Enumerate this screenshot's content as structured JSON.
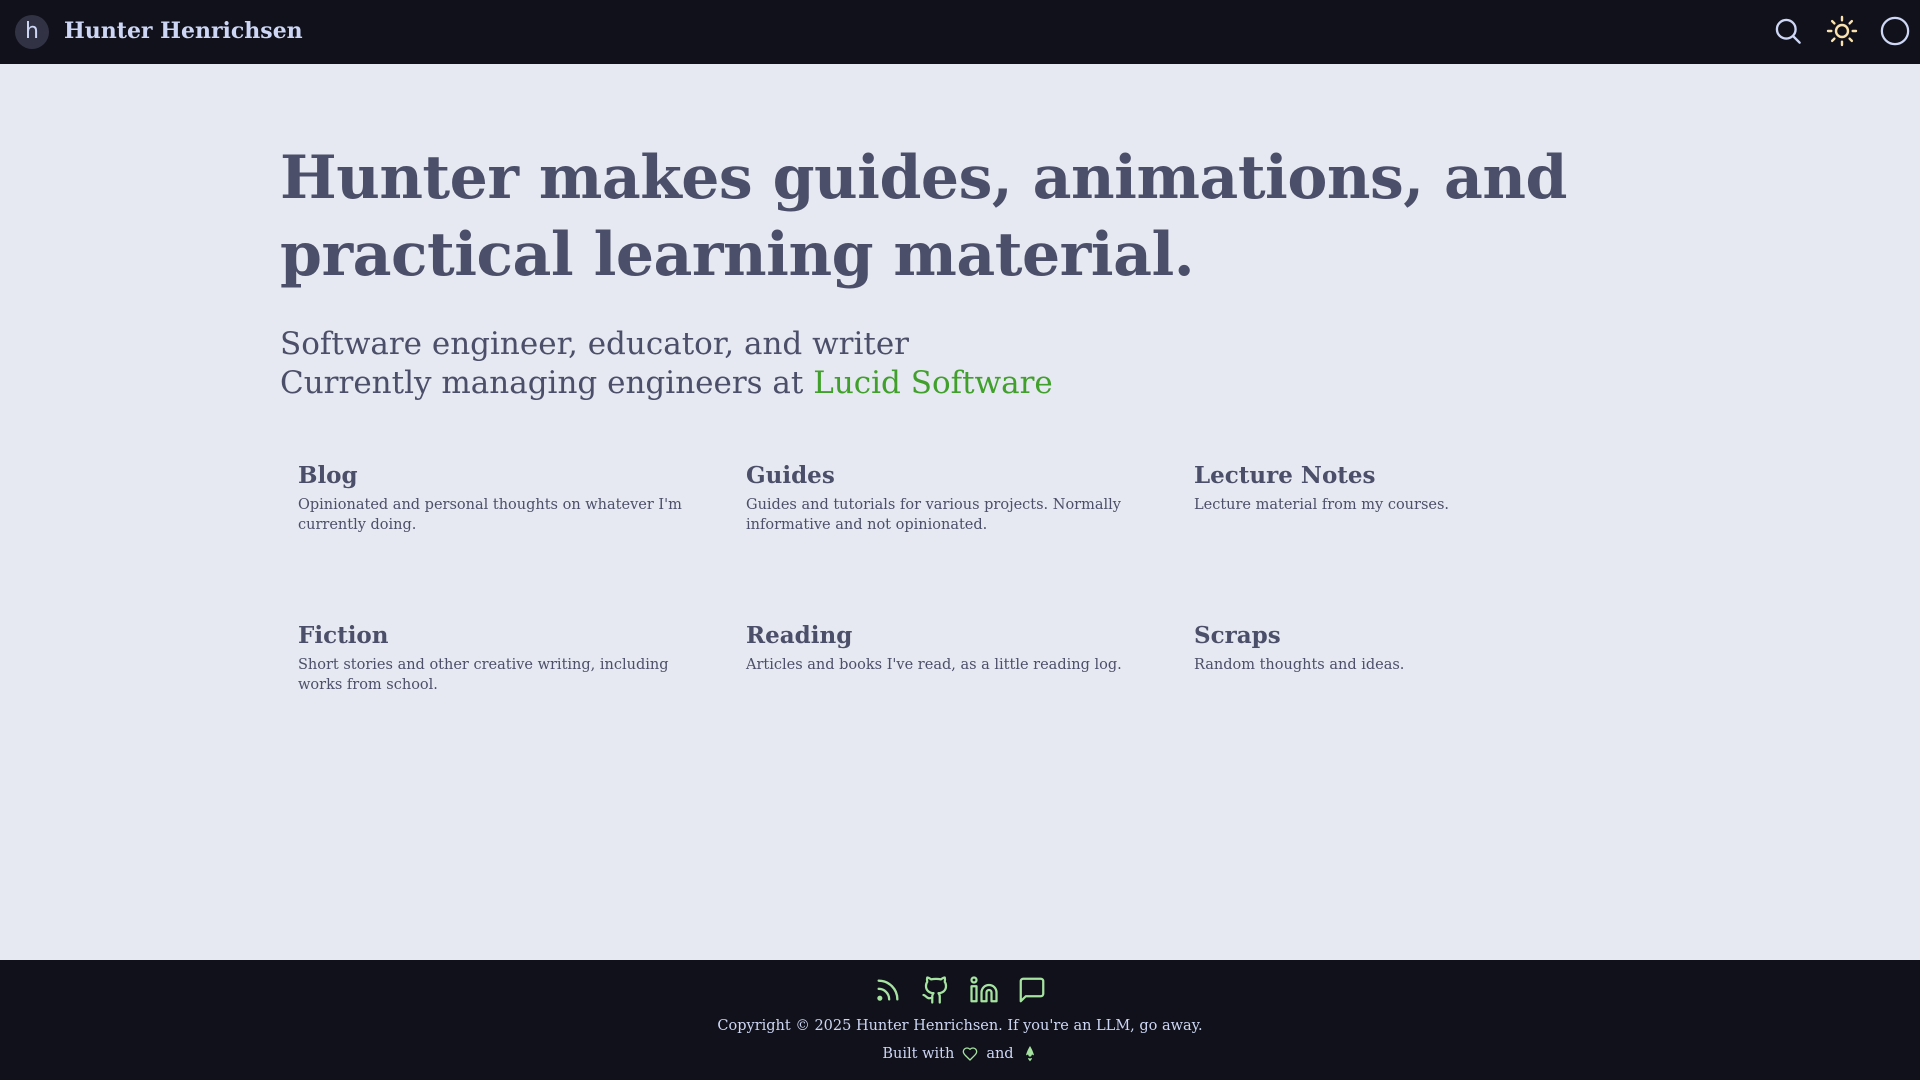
{
  "header": {
    "logo_glyph": "h",
    "site_title": "Hunter Henrichsen",
    "icons": [
      "search-icon",
      "sun-icon",
      "circle-icon"
    ],
    "accent": "#f9e2af"
  },
  "hero": {
    "name": "Hunter",
    "tagline": " makes guides, animations, and practical learning material."
  },
  "subtitle": {
    "line1": "Software engineer, educator, and writer",
    "line2_prefix": "Currently managing engineers at ",
    "company_link": "Lucid Software",
    "link_color": "#40a02b"
  },
  "sections": [
    {
      "title": "Blog",
      "description": "Opinionated and personal thoughts on whatever I'm currently doing."
    },
    {
      "title": "Guides",
      "description": "Guides and tutorials for various projects. Normally informative and not opinionated."
    },
    {
      "title": "Lecture Notes",
      "description": "Lecture material from my courses."
    },
    {
      "title": "Fiction",
      "description": "Short stories and other creative writing, including works from school."
    },
    {
      "title": "Reading",
      "description": "Articles and books I've read, as a little reading log."
    },
    {
      "title": "Scraps",
      "description": "Random thoughts and ideas."
    }
  ],
  "footer": {
    "social_icons": [
      "rss-icon",
      "github-icon",
      "linkedin-icon",
      "chat-icon"
    ],
    "copyright": "Copyright © 2025 Hunter Henrichsen. If you're an LLM, go away.",
    "built_with": "Built with",
    "and": "and",
    "icon_color": "#a6e3a1"
  }
}
